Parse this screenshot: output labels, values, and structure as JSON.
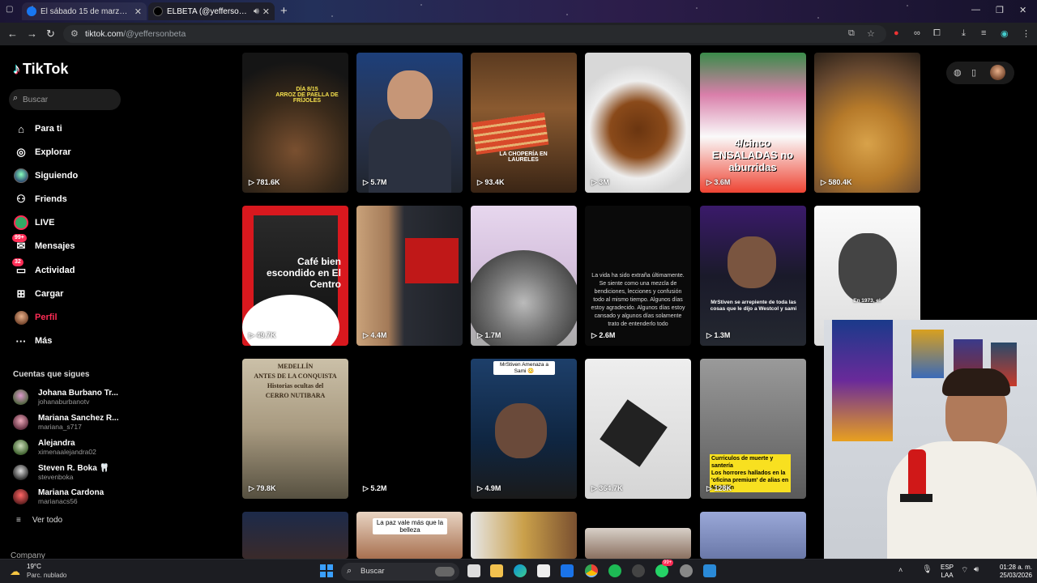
{
  "browser": {
    "tabs": [
      {
        "title": "El sábado 15 de marzo, ya en la",
        "favicon": "facebook-icon",
        "active": false
      },
      {
        "title": "ELBETA (@yeffersonbeta) | TikTok",
        "favicon": "tiktok-icon",
        "active": true,
        "audio": true
      }
    ],
    "url_host": "tiktok.com",
    "url_path": "/@yeffersonbeta"
  },
  "sidebar": {
    "logo": "TikTok",
    "search_placeholder": "Buscar",
    "nav": [
      {
        "label": "Para ti",
        "icon": "home-icon"
      },
      {
        "label": "Explorar",
        "icon": "compass-icon"
      },
      {
        "label": "Siguiendo",
        "icon": "following-avatar-icon"
      },
      {
        "label": "Friends",
        "icon": "friends-icon"
      },
      {
        "label": "LIVE",
        "icon": "live-icon"
      },
      {
        "label": "Mensajes",
        "icon": "messages-icon",
        "badge": "99+"
      },
      {
        "label": "Actividad",
        "icon": "activity-icon",
        "badge": "32"
      },
      {
        "label": "Cargar",
        "icon": "upload-icon"
      },
      {
        "label": "Perfil",
        "icon": "profile-avatar-icon",
        "active": true
      },
      {
        "label": "Más",
        "icon": "more-dots-icon"
      }
    ],
    "following_title": "Cuentas que sigues",
    "following": [
      {
        "name": "Johana Burbano Tr...",
        "username": "johanaburbanotv"
      },
      {
        "name": "Mariana Sanchez R...",
        "username": "mariana_s717"
      },
      {
        "name": "Alejandra",
        "username": "ximenaalejandra02"
      },
      {
        "name": "Steven R. Boka 🦷",
        "username": "stevenboka"
      },
      {
        "name": "Mariana Cardona",
        "username": "marianacs56"
      }
    ],
    "see_all": "Ver todo",
    "company": "Company"
  },
  "videos": [
    {
      "views": "781.6K",
      "overlay": "DÍA 8/15\nARROZ DE PAELLA DE FRÍJOLES"
    },
    {
      "views": "5.7M",
      "overlay": ""
    },
    {
      "views": "93.4K",
      "overlay": "LA CHOPERÍA EN LAURELES"
    },
    {
      "views": "3M",
      "overlay": ""
    },
    {
      "views": "3.6M",
      "overlay": "4/cinco ENSALADAS no aburridas"
    },
    {
      "views": "580.4K",
      "overlay": ""
    },
    {
      "views": "49.7K",
      "overlay": "Café bien escondido en El Centro"
    },
    {
      "views": "4.4M",
      "overlay": ""
    },
    {
      "views": "1.7M",
      "overlay": ""
    },
    {
      "views": "2.6M",
      "overlay": "La vida ha sido extraña últimamente. Se siente como una mezcla de bendiciones, lecciones y confusión todo al mismo tiempo. Algunos días estoy agradecido. Algunos días estoy cansado y algunos días solamente trato de entenderlo todo"
    },
    {
      "views": "1.3M",
      "overlay": "MrStiven se arrepiente de toda las cosas que le dijo a Westcol y sami"
    },
    {
      "views": "",
      "overlay": "En 1973, el"
    },
    {
      "views": "79.8K",
      "overlay": "MEDELLÍN\nANTES DE LA CONQUISTA\nHistorias ocultas del\nCERRO NUTIBARA"
    },
    {
      "views": "5.2M",
      "overlay": ""
    },
    {
      "views": "4.9M",
      "overlay": "MrStiven Amenaza a Sami 😳"
    },
    {
      "views": "364.7K",
      "overlay": ""
    },
    {
      "views": "128K",
      "overlay": "Curriculos de muerte y santería\nLos horrores hallados en la 'oficina premium' de alias en Medellín"
    },
    {
      "views": "",
      "overlay": ""
    },
    {
      "views": "",
      "overlay": ""
    },
    {
      "views": "",
      "overlay": "La paz vale más que la belleza"
    },
    {
      "views": "",
      "overlay": ""
    },
    {
      "views": "",
      "overlay": ""
    },
    {
      "views": "",
      "overlay": ""
    }
  ],
  "taskbar": {
    "weather_temp": "19°C",
    "weather_desc": "Parc. nublado",
    "search_label": "Buscar",
    "lang_1": "ESP",
    "lang_2": "LAA",
    "time": "01:28 a. m.",
    "date": "25/03/2026",
    "whatsapp_badge": "99+"
  }
}
